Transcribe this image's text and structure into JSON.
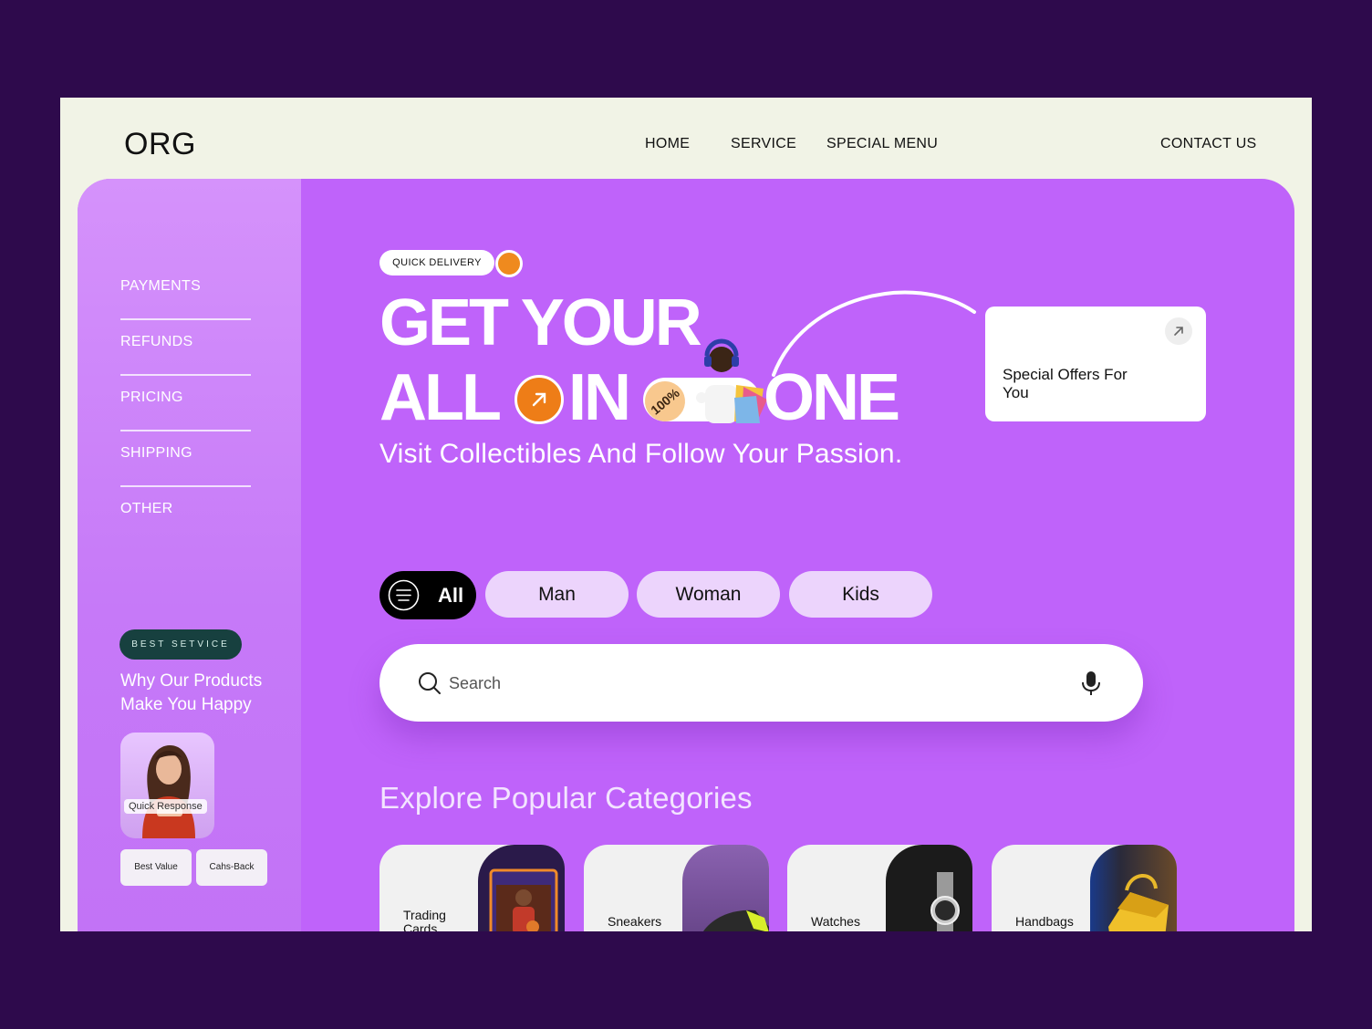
{
  "header": {
    "logo": "ORG",
    "nav": [
      "HOME",
      "SERVICE",
      "SPECIAL MENU"
    ],
    "contact": "CONTACT US"
  },
  "sidebar": {
    "items": [
      "PAYMENTS",
      "REFUNDS",
      "PRICING",
      "SHIPPING",
      "OTHER"
    ],
    "badge": "BEST SETVICE",
    "why": "Why Our Products Make You Happy",
    "profile_label": "Quick Response",
    "mini_buttons": [
      "Best Value",
      "Cahs-Back"
    ]
  },
  "hero": {
    "delivery_pill": "QUICK DELIVERY",
    "line1": "GET YOUR",
    "word_all": "ALL",
    "word_in": "IN",
    "word_one": "ONE",
    "tag": "100%",
    "subtitle": "Visit Collectibles And Follow Your Passion.",
    "offer": "Special Offers For You"
  },
  "filters": {
    "all": "All",
    "options": [
      "Man",
      "Woman",
      "Kids"
    ]
  },
  "search": {
    "placeholder": "Search"
  },
  "categories": {
    "title": "Explore Popular Categories",
    "items": [
      "Trading Cards",
      "Sneakers",
      "Watches",
      "Handbags"
    ]
  },
  "colors": {
    "background": "#2e0a4c",
    "page": "#f1f3e6",
    "accent_purple": "#bf63fa",
    "accent_orange": "#ee7d17",
    "badge_green": "#17403f"
  }
}
